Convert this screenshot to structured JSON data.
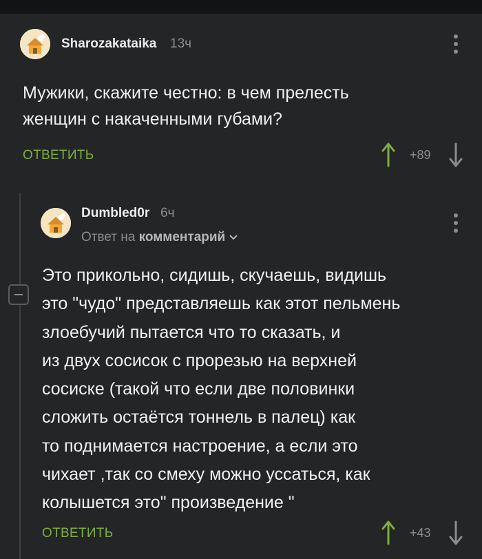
{
  "comments": [
    {
      "author": "Sharozakataika",
      "time": "13ч",
      "text": "Мужики, скажите честно: в чем прелесть\nженщин с накаченными губами?",
      "reply_label": "ОТВЕТИТЬ",
      "score": "+89",
      "avatar_icon": "house-avatar-icon"
    },
    {
      "author": "Dumbled0r",
      "time": "6ч",
      "reply_to_prefix": "Ответ на",
      "reply_to_target": "комментарий",
      "text": "Это прикольно, сидишь, скучаешь, видишь\nэто \"чудо\" представляешь как этот пельмень\nзлоебучий пытается что то сказать, и\nиз двух сосисок с прорезью на верхней\nсосиске (такой что если две половинки\nсложить остаётся тоннель в палец) как\nто поднимается настроение, а если это\nчихает ,так со смеху можно уссаться, как\nколышется это\" произведение \"",
      "reply_label": "ОТВЕТИТЬ",
      "score": "+43",
      "avatar_icon": "house-avatar-icon"
    }
  ],
  "colors": {
    "background": "#232526",
    "accent_reply": "#7fae3e",
    "upvote": "#7fae3e",
    "downvote": "#8a8d90"
  }
}
